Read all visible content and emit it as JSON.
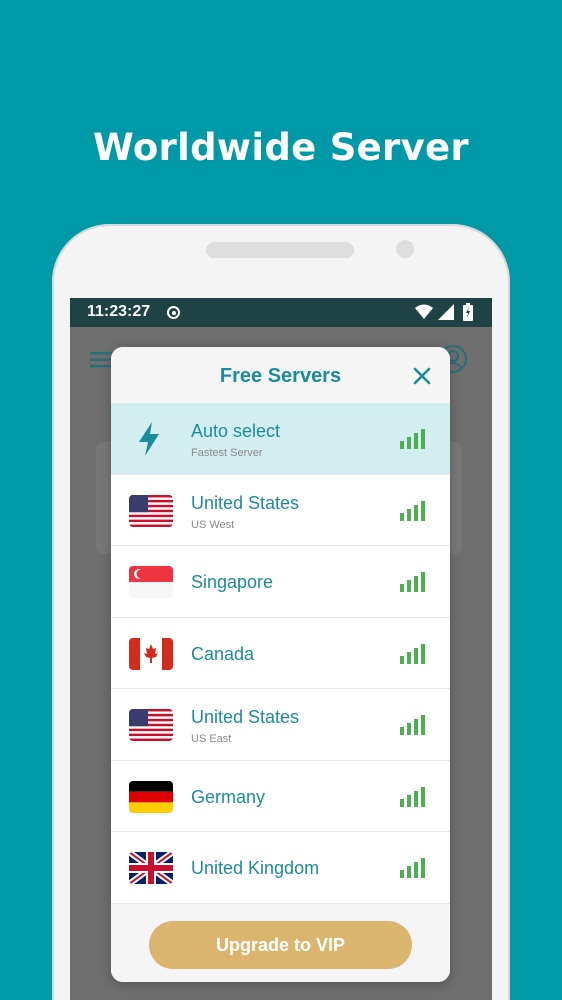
{
  "headline": "Worldwide Server",
  "status_bar": {
    "time": "11:23:27"
  },
  "dialog": {
    "title": "Free Servers",
    "upgrade_label": "Upgrade to VIP"
  },
  "servers": [
    {
      "name": "Auto select",
      "subtitle": "Fastest Server",
      "icon": "lightning-icon",
      "selected": true
    },
    {
      "name": "United States",
      "subtitle": "US West",
      "icon": "us-flag-icon",
      "selected": false
    },
    {
      "name": "Singapore",
      "subtitle": "",
      "icon": "singapore-flag-icon",
      "selected": false
    },
    {
      "name": "Canada",
      "subtitle": "",
      "icon": "canada-flag-icon",
      "selected": false
    },
    {
      "name": "United States",
      "subtitle": "US East",
      "icon": "us-flag-icon",
      "selected": false
    },
    {
      "name": "Germany",
      "subtitle": "",
      "icon": "germany-flag-icon",
      "selected": false
    },
    {
      "name": "United Kingdom",
      "subtitle": "",
      "icon": "uk-flag-icon",
      "selected": false
    }
  ],
  "colors": {
    "background": "#0099a8",
    "accent": "#1a8c9c",
    "signal_green": "#4caf50",
    "vip_gold": "#dbb46e",
    "selected_row": "#d3eef0"
  }
}
